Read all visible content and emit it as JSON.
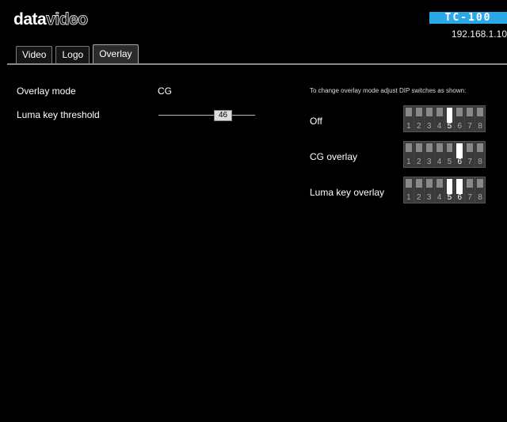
{
  "header": {
    "logo_part1": "data",
    "logo_part2": "video",
    "model": "TC-100",
    "ip": "192.168.1.10"
  },
  "tabs": [
    {
      "label": "Video",
      "active": false
    },
    {
      "label": "Logo",
      "active": false
    },
    {
      "label": "Overlay",
      "active": true
    }
  ],
  "settings": {
    "overlay_mode_label": "Overlay mode",
    "overlay_mode_value": "CG",
    "luma_threshold_label": "Luma key threshold",
    "luma_threshold_value": "46"
  },
  "dip": {
    "note": "To change overlay mode adjust DIP switches as shown:",
    "configs": [
      {
        "label": "Off",
        "numbers": [
          "1",
          "2",
          "3",
          "4",
          "5",
          "6",
          "7",
          "8"
        ],
        "on": [
          false,
          false,
          false,
          false,
          true,
          false,
          false,
          false
        ]
      },
      {
        "label": "CG overlay",
        "numbers": [
          "1",
          "2",
          "3",
          "4",
          "5",
          "6",
          "7",
          "8"
        ],
        "on": [
          false,
          false,
          false,
          false,
          false,
          true,
          false,
          false
        ]
      },
      {
        "label": "Luma key overlay",
        "numbers": [
          "1",
          "2",
          "3",
          "4",
          "5",
          "6",
          "7",
          "8"
        ],
        "on": [
          false,
          false,
          false,
          false,
          true,
          true,
          false,
          false
        ]
      }
    ]
  }
}
